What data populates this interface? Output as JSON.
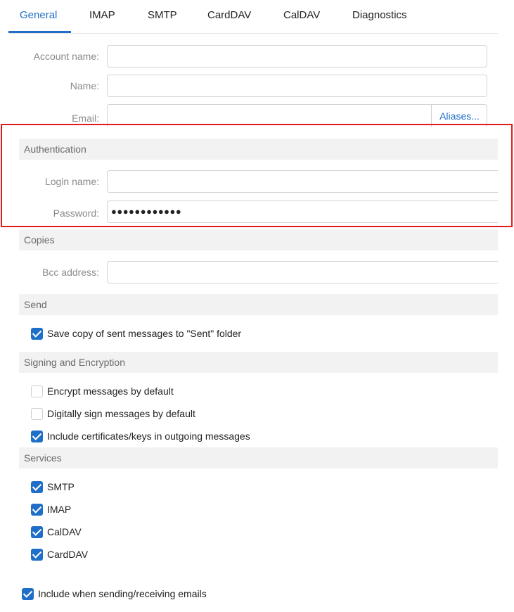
{
  "tabs": [
    {
      "label": "General"
    },
    {
      "label": "IMAP"
    },
    {
      "label": "SMTP"
    },
    {
      "label": "CardDAV"
    },
    {
      "label": "CalDAV"
    },
    {
      "label": "Diagnostics"
    }
  ],
  "fields": {
    "account_name_label": "Account name:",
    "name_label": "Name:",
    "email_label": "Email:",
    "aliases_label": "Aliases..."
  },
  "authentication": {
    "title": "Authentication",
    "login_label": "Login name:",
    "password_label": "Password:",
    "password_masked": "●●●●●●●●●●●●"
  },
  "copies": {
    "title": "Copies",
    "bcc_label": "Bcc address:"
  },
  "send": {
    "title": "Send",
    "save_copy_label": "Save copy of sent messages to \"Sent\" folder"
  },
  "signing": {
    "title": "Signing and Encryption",
    "encrypt_label": "Encrypt messages by default",
    "sign_label": "Digitally sign messages by default",
    "include_certs_label": "Include certificates/keys in outgoing messages"
  },
  "services": {
    "title": "Services",
    "smtp_label": "SMTP",
    "imap_label": "IMAP",
    "caldav_label": "CalDAV",
    "carddav_label": "CardDAV"
  },
  "include_sending_label": "Include when sending/receiving emails",
  "colors": {
    "accent": "#1f6fc8",
    "highlight": "#e01b1b",
    "section_bg": "#f2f2f2"
  }
}
